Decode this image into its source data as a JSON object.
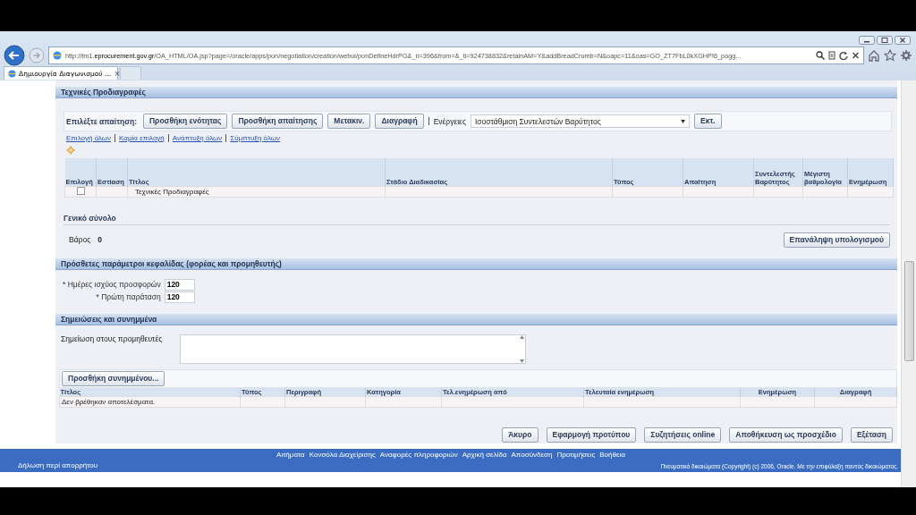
{
  "browser": {
    "url": "http://tm1.**eprocurement.gov.gr**/OA_HTML/OA.jsp?page=/oracle/apps/pon/negotiation/creation/webui/ponDefineHdrPG&_ri=396&from=&_ti=924738832&retainAM=Y&addBreadCrumb=N&oapc=11&oas=GO_ZT7FbL0kXGHPI6_pogg...",
    "tab_title": "Δημιουργία Διαγωνισμού ...",
    "tab_close": "×"
  },
  "requirements": {
    "title": "Τεχνικές Προδιαγραφές",
    "toolbar_label": "Επιλέξτε απαίτηση:",
    "buttons": [
      "Προσθήκη ενότητας",
      "Προσθήκη απαίτησης",
      "Μετακιν.",
      "Διαγραφή"
    ],
    "actions_label": "Ενέργειες",
    "actions_value": "Ισοστάθμιση Συντελεστών Βαρύτητος",
    "go_button": "Εκτ.",
    "links": [
      "Επιλογή όλων",
      "Καμία επιλογή",
      "Ανάπτυξη όλων",
      "Σύμπτυξη όλων"
    ],
    "columns": [
      "Επιλογή",
      "Εστίαση",
      "Τίτλος",
      "Στάδιο Διαδικασίας",
      "Τύπος",
      "Απαίτηση",
      "Συντελεστής Βαρύτητος",
      "Μέγιστη βαθμολογία",
      "Ενημέρωση"
    ],
    "rows": [
      {
        "checked": false,
        "title": "Τεχνικές Προδιαγραφές"
      }
    ],
    "total_title": "Γενικό σύνολο",
    "weight_label": "Βάρος",
    "weight_value": "0",
    "recalc_button": "Επανάληψη υπολογισμού"
  },
  "header_params": {
    "title": "Πρόσθετες παράμετροι κεφαλίδας (φορέας και προμηθευτής)",
    "fields": [
      {
        "label": "* Ημέρες ισχύος προσφορών",
        "value": "120"
      },
      {
        "label": "* Πρώτη παράταση",
        "value": "120"
      }
    ]
  },
  "notes": {
    "title": "Σημειώσεις και συνημμένα",
    "note_label": "Σημείωση στους προμηθευτές",
    "add_button": "Προσθήκη συνημμένου...",
    "columns": [
      "Τίτλος",
      "Τύπος",
      "Περιγραφή",
      "Κατηγορία",
      "Τελ.ενημέρωση από",
      "Τελευταία ενημέρωση",
      "Ενημέρωση",
      "Διαγραφή"
    ],
    "empty_message": "Δεν βρέθηκαν αποτελέσματα."
  },
  "page_buttons": [
    "Άκυρο",
    "Εφαρμογή προτύπου",
    "Συζητήσεις online",
    "Αποθήκευση ως προσχέδιο",
    "Εξέταση"
  ],
  "footer": {
    "links": [
      "Αιτήματα",
      "Κονσόλα Διαχείρισης",
      "Αναφορές πληροφοριών",
      "Αρχική σελίδα",
      "Αποσύνδεση",
      "Προτιμήσεις",
      "Βοήθεια"
    ],
    "privacy": "Δήλωση περί απορρήτου",
    "copyright": "Πνευματικά δικαιώματα (Copyright) (c) 2006, Oracle. Με την επιφύλαξη παντός δικαιώματος."
  }
}
